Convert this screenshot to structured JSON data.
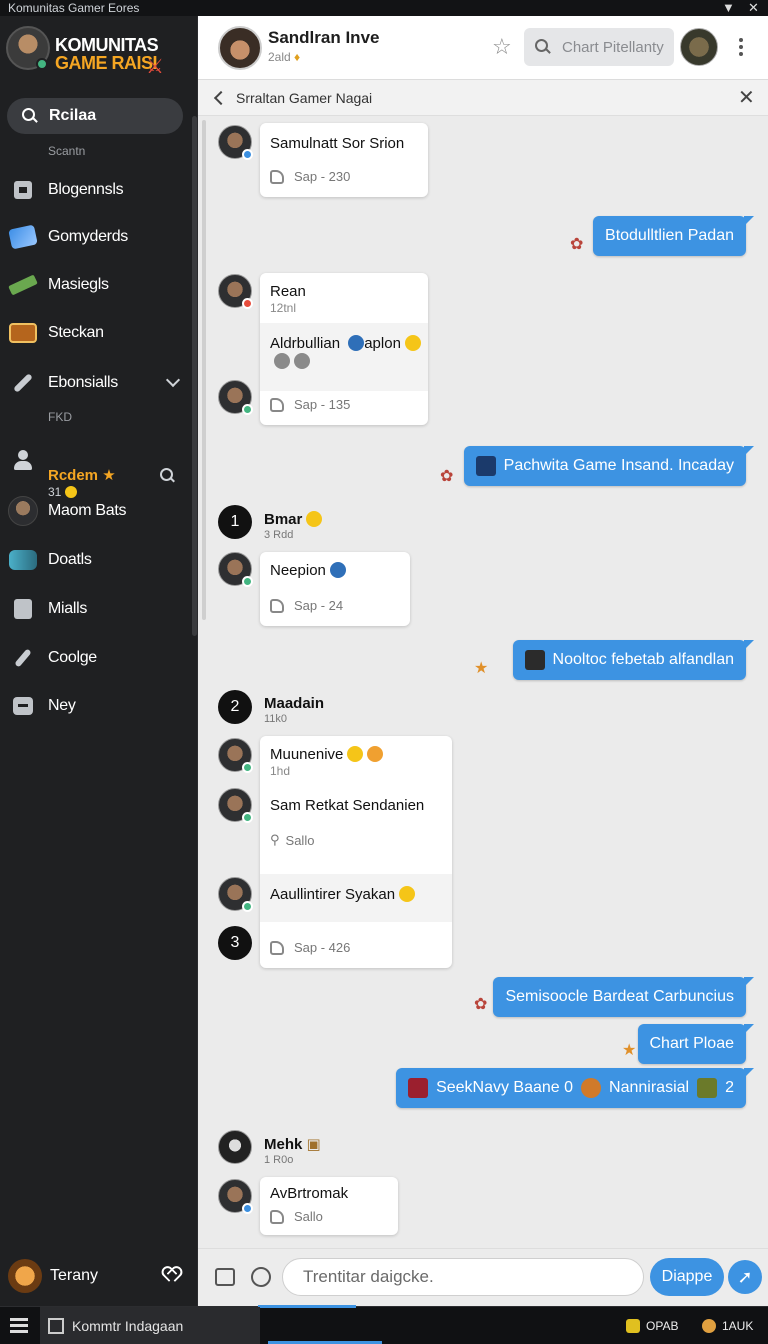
{
  "window": {
    "title": "Komunitas Gamer Eores"
  },
  "sidebar": {
    "logo_line1": "KOMUNITAS",
    "logo_line2": "GAME RAISI",
    "search_label": "Rcilaa",
    "search_sub": "Scantn",
    "items": [
      {
        "label": "Blogennsls",
        "icon": "chat-square-icon"
      },
      {
        "label": "Gomyderds",
        "icon": "gem-icon"
      },
      {
        "label": "Masiegls",
        "icon": "gun-icon"
      },
      {
        "label": "Steckan",
        "icon": "chest-icon"
      },
      {
        "label": "Ebonsialls",
        "icon": "wrench-icon"
      }
    ],
    "section_label": "FKD",
    "recent_label": "Rcdem",
    "recent_count": "31",
    "friends": [
      {
        "label": "Maom Bats",
        "icon": "avatar"
      },
      {
        "label": "Doatls",
        "icon": "robot-icon"
      },
      {
        "label": "Mialls",
        "icon": "bag-icon"
      },
      {
        "label": "Coolge",
        "icon": "brush-icon"
      },
      {
        "label": "Ney",
        "icon": "chat-icon"
      }
    ],
    "bottom_user": "Terany"
  },
  "header": {
    "title": "Sandlran Inve",
    "subtitle": "2ald",
    "search_placeholder": "Chart Pitellanty"
  },
  "subbar": {
    "title": "Srraltan Gamer Nagai"
  },
  "messages": {
    "card1": {
      "name": "Samulnatt Sor Srion",
      "footer": "Sap - 230"
    },
    "out1": "Btodulltlien Padan",
    "card2": {
      "name": "Rean",
      "meta": "12tnl",
      "line2": "Aldrbullian",
      "line2b": "aplon",
      "footer": "Sap - 135"
    },
    "out2": "Pachwita Game Insand. Incaday",
    "group1": {
      "sender": "Bmar",
      "sender_sub": "3 Rdd",
      "num": "1"
    },
    "card3": {
      "name": "Neepion",
      "footer": "Sap - 24"
    },
    "out3": "Nooltoc febetab alfandlan",
    "group2": {
      "sender": "Maadain",
      "sender_sub": "11k0",
      "num": "2"
    },
    "card4": {
      "name1": "Muunenive",
      "meta1": "1hd",
      "name2": "Sam Retkat Sendanien",
      "footer2": "Sallo",
      "name3": "Aaullintirer Syakan",
      "footer3": "Sap - 426",
      "num": "3"
    },
    "out4": "Semisoocle Bardeat Carbuncius",
    "out5": "Chart Ploae",
    "out6a": "SeekNavy Baane 0",
    "out6b": "Nannirasial",
    "out6c": "2",
    "group3": {
      "sender": "Mehk",
      "sender_sub": "1 R0o"
    },
    "card5": {
      "name": "AvBrtromak",
      "footer": "Sallo"
    }
  },
  "composer": {
    "placeholder": "Trentitar daigcke.",
    "send_label": "Diappe"
  },
  "taskbar": {
    "app_label": "Kommtr Indagaan",
    "tray1": "OPAB",
    "tray2": "1AUK"
  },
  "colors": {
    "accent": "#3d93e2",
    "sidebar": "#1f2022",
    "gold": "#f5a623"
  }
}
